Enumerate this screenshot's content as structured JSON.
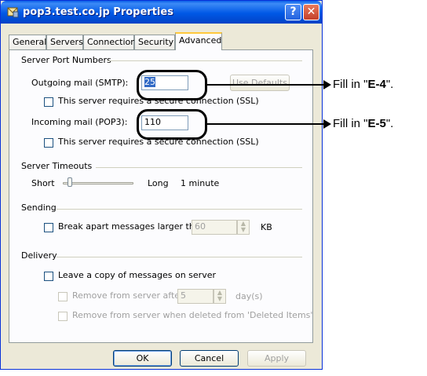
{
  "window": {
    "title": "pop3.test.co.jp Properties",
    "help_label": "?",
    "close_label": "✕"
  },
  "tabs": [
    "General",
    "Servers",
    "Connection",
    "Security",
    "Advanced"
  ],
  "active_tab": "Advanced",
  "server_ports": {
    "group_label": "Server Port Numbers",
    "outgoing_label": "Outgoing mail (SMTP):",
    "outgoing_value": "25",
    "use_defaults_label": "Use Defaults",
    "smtp_ssl_label": "This server requires a secure connection (SSL)",
    "incoming_label": "Incoming mail (POP3):",
    "incoming_value": "110",
    "pop3_ssl_label": "This server requires a secure connection (SSL)"
  },
  "timeouts": {
    "group_label": "Server Timeouts",
    "short_label": "Short",
    "long_label": "Long",
    "value_label": "1 minute",
    "slider_level": 0.1
  },
  "sending": {
    "group_label": "Sending",
    "break_apart_label": "Break apart messages larger than",
    "size_value": "60",
    "unit_label": "KB"
  },
  "delivery": {
    "group_label": "Delivery",
    "leave_copy_label": "Leave a copy of messages on server",
    "remove_after_label": "Remove from server after",
    "days_value": "5",
    "days_unit": "day(s)",
    "remove_deleted_label": "Remove from server when deleted from 'Deleted Items'"
  },
  "buttons": {
    "ok": "OK",
    "cancel": "Cancel",
    "apply": "Apply"
  },
  "annotations": {
    "e4_prefix": "Fill in \"",
    "e4_code": "E-4",
    "e4_suffix": "\".",
    "e5_prefix": "Fill in \"",
    "e5_code": "E-5",
    "e5_suffix": "\"."
  }
}
